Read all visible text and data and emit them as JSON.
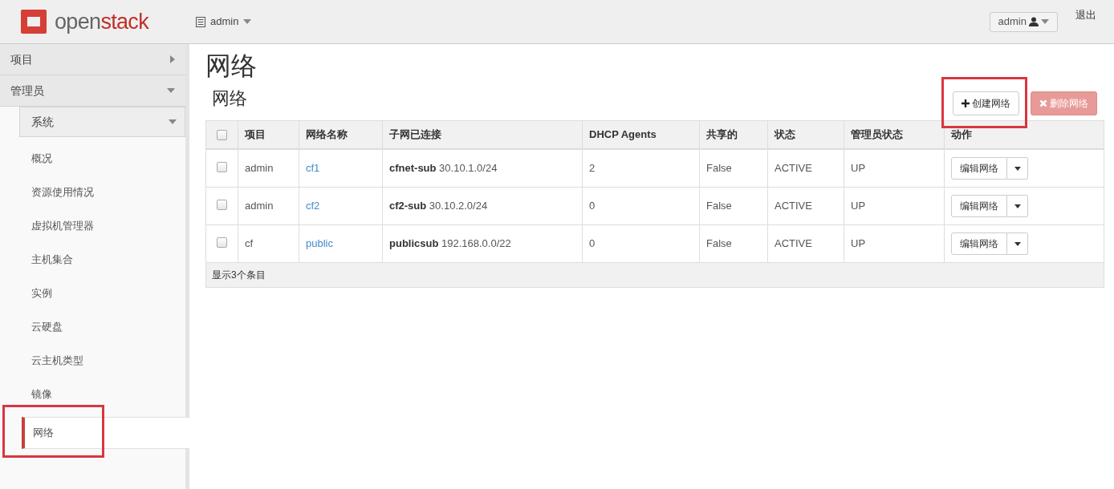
{
  "header": {
    "logo": {
      "part_1": "open",
      "part_2": "stack"
    },
    "project_menu": "admin",
    "user_menu": "admin",
    "logout": "退出"
  },
  "sidebar": {
    "sections": [
      {
        "label": "项目",
        "expanded": false
      },
      {
        "label": "管理员",
        "expanded": true,
        "children": [
          {
            "label": "系统",
            "expanded": true,
            "children": [
              {
                "label": "概况",
                "selected": false,
                "highlighted": false
              },
              {
                "label": "资源使用情况",
                "selected": false,
                "highlighted": false
              },
              {
                "label": "虚拟机管理器",
                "selected": false,
                "highlighted": false
              },
              {
                "label": "主机集合",
                "selected": false,
                "highlighted": false
              },
              {
                "label": "实例",
                "selected": false,
                "highlighted": false
              },
              {
                "label": "云硬盘",
                "selected": false,
                "highlighted": false
              },
              {
                "label": "云主机类型",
                "selected": false,
                "highlighted": false
              },
              {
                "label": "镜像",
                "selected": false,
                "highlighted": false
              },
              {
                "label": "网络",
                "selected": true,
                "highlighted": true
              }
            ]
          }
        ]
      }
    ]
  },
  "page": {
    "title": "网络",
    "table_title": "网络",
    "actions": [
      {
        "label": "创建网络",
        "kind": "create",
        "disabled": false,
        "highlighted": true
      },
      {
        "label": "删除网络",
        "kind": "delete",
        "disabled": true,
        "highlighted": false
      }
    ],
    "table": {
      "select_all_checked": false,
      "columns": [
        "项目",
        "网络名称",
        "子网已连接",
        "DHCP Agents",
        "共享的",
        "状态",
        "管理员状态",
        "动作"
      ],
      "rows": [
        {
          "checked": false,
          "project": "admin",
          "name": "cf1",
          "subnets": "**cfnet-sub** 30.10.1.0/24",
          "dhcp_agents": "2",
          "shared": "False",
          "status": "ACTIVE",
          "admin_state": "UP",
          "action": "编辑网络"
        },
        {
          "checked": false,
          "project": "admin",
          "name": "cf2",
          "subnets": "**cf2-sub** 30.10.2.0/24",
          "dhcp_agents": "0",
          "shared": "False",
          "status": "ACTIVE",
          "admin_state": "UP",
          "action": "编辑网络"
        },
        {
          "checked": false,
          "project": "cf",
          "name": "public",
          "subnets": "**publicsub** 192.168.0.0/22",
          "dhcp_agents": "0",
          "shared": "False",
          "status": "ACTIVE",
          "admin_state": "UP",
          "action": "编辑网络"
        }
      ],
      "footer": "显示3个条目"
    }
  }
}
